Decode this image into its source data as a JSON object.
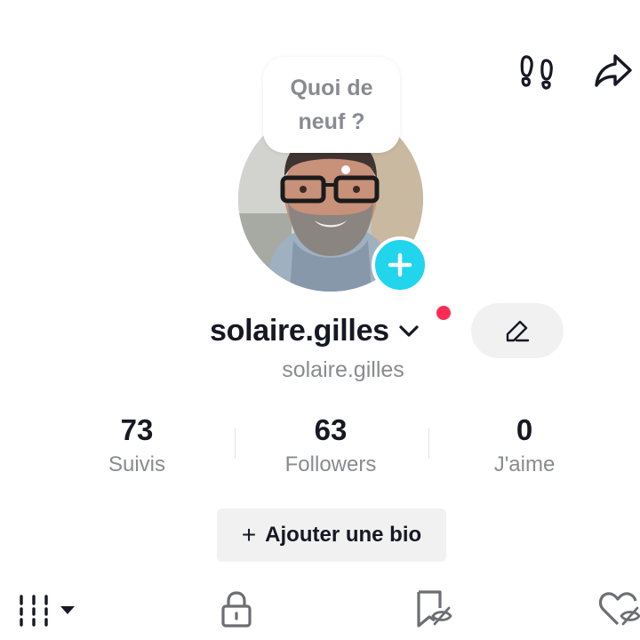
{
  "header": {
    "footprints_icon": "footprints-icon",
    "share_icon": "share-arrow-icon"
  },
  "profile": {
    "bubble_text": "Quoi de neuf ?",
    "username": "solaire.gilles",
    "handle": "solaire.gilles",
    "add_story_icon": "plus-icon",
    "edit_icon": "pencil-icon",
    "notification_color": "#fe2c55",
    "accent_color": "#20d5ec"
  },
  "stats": [
    {
      "value": "73",
      "label": "Suivis"
    },
    {
      "value": "63",
      "label": "Followers"
    },
    {
      "value": "0",
      "label": "J'aime"
    }
  ],
  "bio_button": {
    "plus": "+",
    "label": "Ajouter une bio"
  },
  "tabs": [
    {
      "icon": "grid-columns-icon"
    },
    {
      "icon": "lock-icon"
    },
    {
      "icon": "bookmark-hidden-icon"
    },
    {
      "icon": "heart-hidden-icon"
    }
  ]
}
